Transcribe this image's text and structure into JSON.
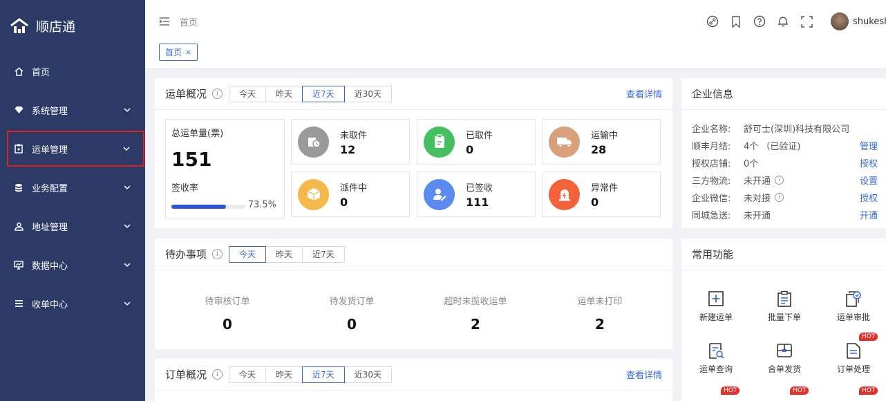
{
  "app": {
    "name": "顺店通"
  },
  "sidebar": {
    "items": [
      {
        "label": "首页",
        "icon": "home-icon"
      },
      {
        "label": "系统管理",
        "icon": "diamond-icon"
      },
      {
        "label": "运单管理",
        "icon": "clipboard-icon"
      },
      {
        "label": "业务配置",
        "icon": "database-icon"
      },
      {
        "label": "地址管理",
        "icon": "person-pin-icon"
      },
      {
        "label": "数据中心",
        "icon": "monitor-chart-icon"
      },
      {
        "label": "收单中心",
        "icon": "list-icon"
      }
    ]
  },
  "header": {
    "breadcrumb": "首页",
    "user_name": "shukeshi",
    "icons": [
      "link-icon",
      "bookmark-icon",
      "help-icon",
      "bell-icon",
      "fullscreen-icon"
    ]
  },
  "tabs": [
    {
      "label": "首页",
      "close": "×"
    }
  ],
  "waybill_overview": {
    "title": "运单概况",
    "info": "i",
    "ranges": [
      "今天",
      "昨天",
      "近7天",
      "近30天"
    ],
    "active_range": "近7天",
    "more": "查看详情",
    "total_label": "总运单量(票)",
    "total_value": "151",
    "sign_rate_label": "签收率",
    "sign_rate": "73.5%",
    "sign_rate_fraction": 0.735,
    "stats": [
      {
        "label": "未取件",
        "value": "12",
        "color": "#9a9a9a",
        "icon": "parcel-clock-icon"
      },
      {
        "label": "已取件",
        "value": "0",
        "color": "#44c061",
        "icon": "clipboard-check-icon"
      },
      {
        "label": "运输中",
        "value": "28",
        "color": "#d9a07c",
        "icon": "truck-icon"
      },
      {
        "label": "派件中",
        "value": "0",
        "color": "#f5b84a",
        "icon": "box-icon"
      },
      {
        "label": "已签收",
        "value": "111",
        "color": "#5b8af0",
        "icon": "person-sign-icon"
      },
      {
        "label": "异常件",
        "value": "0",
        "color": "#f4623a",
        "icon": "alert-icon"
      }
    ]
  },
  "todo": {
    "title": "待办事项",
    "info": "i",
    "ranges": [
      "今天",
      "昨天",
      "近7天"
    ],
    "active_range": "今天",
    "items": [
      {
        "label": "待审核订单",
        "value": "0"
      },
      {
        "label": "待发货订单",
        "value": "0"
      },
      {
        "label": "超时未揽收运单",
        "value": "2"
      },
      {
        "label": "运单未打印",
        "value": "2"
      }
    ]
  },
  "order_overview": {
    "title": "订单概况",
    "info": "i",
    "ranges": [
      "今天",
      "昨天",
      "近7天",
      "近30天"
    ],
    "active_range": "近7天",
    "more": "查看详情"
  },
  "enterprise": {
    "title": "企业信息",
    "rows": [
      {
        "key": "企业名称:",
        "value": "舒可士(深圳)科技有限公司",
        "action": "",
        "info": false
      },
      {
        "key": "顺丰月结:",
        "value": "4个 （已验证)",
        "action": "管理",
        "info": false
      },
      {
        "key": "授权店铺:",
        "value": "0个",
        "action": "授权",
        "info": false
      },
      {
        "key": "三方物流:",
        "value": "未开通",
        "action": "设置",
        "info": true
      },
      {
        "key": "企业微信:",
        "value": "未对接",
        "action": "授权",
        "info": true
      },
      {
        "key": "同城急送:",
        "value": "未开通",
        "action": "开通",
        "info": false
      }
    ]
  },
  "functions": {
    "title": "常用功能",
    "hot_label": "HOT",
    "items": [
      {
        "label": "新建运单",
        "icon": "plus-square-icon",
        "hot": false
      },
      {
        "label": "批量下单",
        "icon": "clipboard-list-icon",
        "hot": false
      },
      {
        "label": "运单审批",
        "icon": "doc-check-icon",
        "hot": false
      },
      {
        "label": "运单查询",
        "icon": "doc-search-icon",
        "hot": false
      },
      {
        "label": "合单发货",
        "icon": "merge-box-icon",
        "hot": false
      },
      {
        "label": "订单处理",
        "icon": "doc-lines-icon",
        "hot": true
      }
    ]
  },
  "colors": {
    "sidebar": "#2c3a66",
    "accent": "#3a6bd6",
    "highlight": "#e02020"
  }
}
